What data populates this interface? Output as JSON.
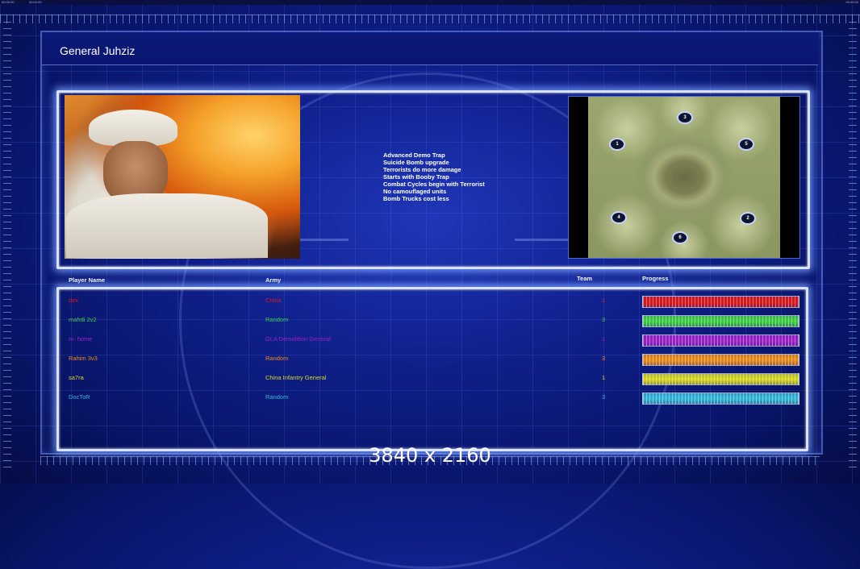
{
  "topbar": {
    "left_text": "00:00:00",
    "left_text2": "00:00:00",
    "right_text": "00:00:00"
  },
  "title": "General Juhziz",
  "bonuses": [
    "Advanced Demo Trap",
    "Suicide Bomb upgrade",
    "Terrorists do more damage",
    "Starts with Booby Trap",
    "Combat Cycles begin with Terrorist",
    "No camouflaged units",
    "Bomb Trucks cost less"
  ],
  "map": {
    "spawns": [
      "3",
      "1",
      "5",
      "4",
      "2",
      "6"
    ]
  },
  "table": {
    "headers": {
      "player": "Player Name",
      "army": "Army",
      "team": "Team",
      "progress": "Progress"
    },
    "rows": [
      {
        "player": "dex",
        "army": "China",
        "team": "1",
        "color": "#e01818",
        "progress": 1.0
      },
      {
        "player": "mahdi 2v2",
        "army": "Random",
        "team": "3",
        "color": "#3ed13e",
        "progress": 1.0
      },
      {
        "player": "m- home",
        "army": "GLA Demolition General",
        "team": "1",
        "color": "#a020c8",
        "progress": 1.0
      },
      {
        "player": "Rahim 3v3",
        "army": "Random",
        "team": "3",
        "color": "#f08c14",
        "progress": 1.0
      },
      {
        "player": "sa7ra",
        "army": "China Infantry General",
        "team": "1",
        "color": "#d8d81c",
        "progress": 1.0
      },
      {
        "player": "DocToR",
        "army": "Random",
        "team": "3",
        "color": "#33b8d6",
        "progress": 1.0
      }
    ]
  },
  "watermark": "3840 x 2160"
}
